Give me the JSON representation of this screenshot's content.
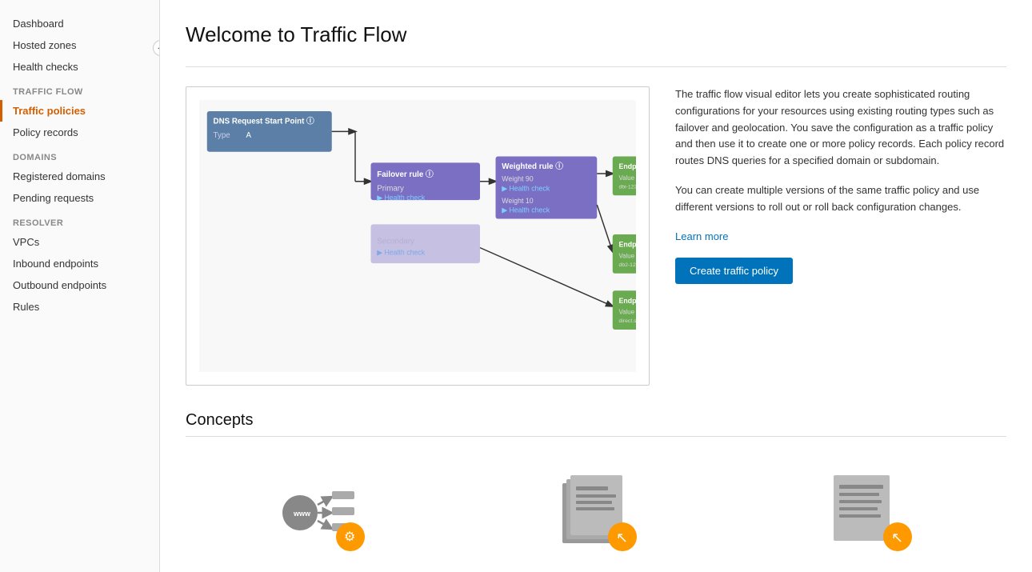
{
  "sidebar": {
    "collapse_icon": "◀",
    "items_top": [
      {
        "label": "Dashboard",
        "name": "dashboard",
        "active": false
      },
      {
        "label": "Hosted zones",
        "name": "hosted-zones",
        "active": false
      },
      {
        "label": "Health checks",
        "name": "health-checks",
        "active": false
      }
    ],
    "sections": [
      {
        "label": "Traffic flow",
        "name": "traffic-flow",
        "items": [
          {
            "label": "Traffic policies",
            "name": "traffic-policies",
            "active": true
          },
          {
            "label": "Policy records",
            "name": "policy-records",
            "active": false
          }
        ]
      },
      {
        "label": "Domains",
        "name": "domains",
        "items": [
          {
            "label": "Registered domains",
            "name": "registered-domains",
            "active": false
          },
          {
            "label": "Pending requests",
            "name": "pending-requests",
            "active": false
          }
        ]
      },
      {
        "label": "Resolver",
        "name": "resolver",
        "items": [
          {
            "label": "VPCs",
            "name": "vpcs",
            "active": false
          },
          {
            "label": "Inbound endpoints",
            "name": "inbound-endpoints",
            "active": false
          },
          {
            "label": "Outbound endpoints",
            "name": "outbound-endpoints",
            "active": false
          },
          {
            "label": "Rules",
            "name": "rules",
            "active": false
          }
        ]
      }
    ]
  },
  "main": {
    "title": "Welcome to Traffic Flow",
    "description1": "The traffic flow visual editor lets you create sophisticated routing configurations for your resources using existing routing types such as failover and geolocation. You save the configuration as a traffic policy and then use it to create one or more policy records. Each policy record routes DNS queries for a specified domain or subdomain.",
    "description2": "You can create multiple versions of the same traffic policy and use different versions to roll out or roll back configuration changes.",
    "learn_more_label": "Learn more",
    "create_btn_label": "Create traffic policy",
    "concepts_title": "Concepts"
  }
}
